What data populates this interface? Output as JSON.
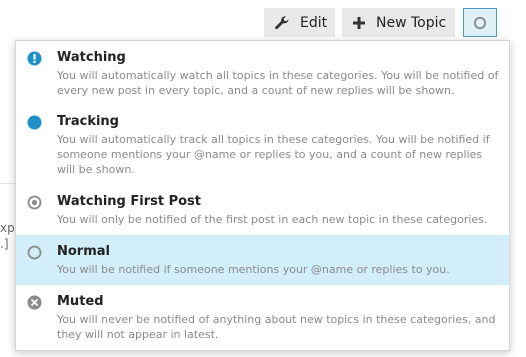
{
  "toolbar": {
    "edit_label": "Edit",
    "new_topic_label": "New Topic",
    "edit_icon": "wrench-icon",
    "new_topic_icon": "plus-icon",
    "notification_icon": "circle-outline-icon"
  },
  "background": {
    "fragment1": "xpe",
    "fragment2": ".]"
  },
  "notification_menu": {
    "selected": "Normal",
    "highlight_color": "#d1eef9",
    "options": [
      {
        "title": "Watching",
        "description": "You will automatically watch all topics in these categories. You will be notified of every new post in every topic, and a count of new replies will be shown.",
        "icon": "exclamation-circle-icon",
        "color": "#1f8fc7"
      },
      {
        "title": "Tracking",
        "description": "You will automatically track all topics in these categories. You will be notified if someone mentions your @name or replies to you, and a count of new replies will be shown.",
        "icon": "filled-circle-icon",
        "color": "#1f8fc7"
      },
      {
        "title": "Watching First Post",
        "description": "You will only be notified of the first post in each new topic in these categories.",
        "icon": "dot-circle-icon",
        "color": "#8a8a8a"
      },
      {
        "title": "Normal",
        "description": "You will be notified if someone mentions your @name or replies to you.",
        "icon": "circle-outline-icon",
        "color": "#8a8a8a"
      },
      {
        "title": "Muted",
        "description": "You will never be notified of anything about new topics in these categories, and they will not appear in latest.",
        "icon": "times-circle-icon",
        "color": "#8a8a8a"
      }
    ]
  }
}
